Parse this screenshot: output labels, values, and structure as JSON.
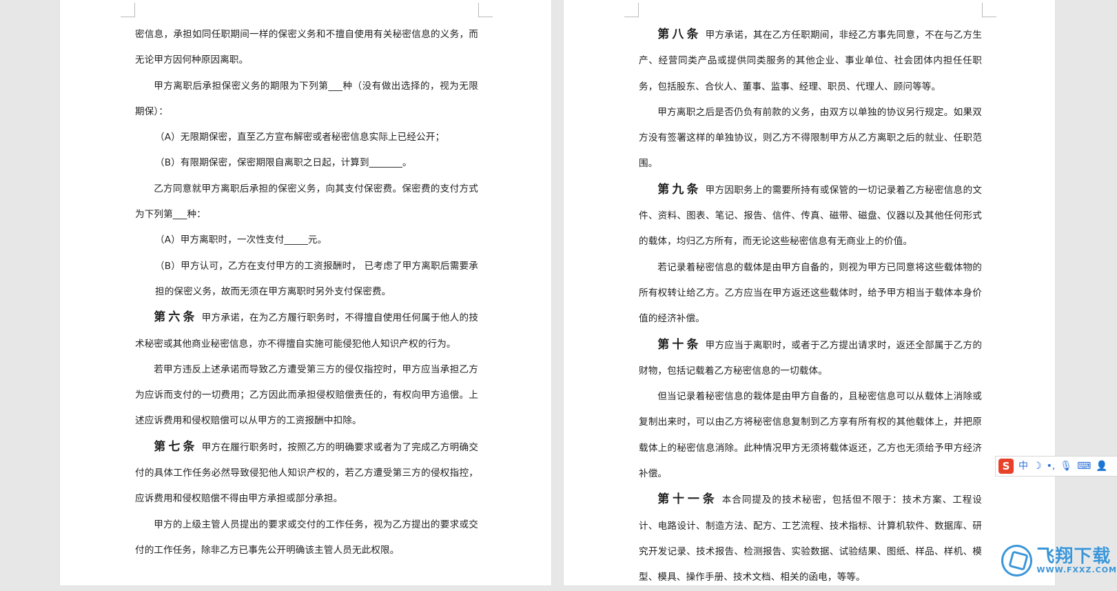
{
  "left_page": {
    "paragraphs": [
      {
        "style": "plain",
        "text": "密信息，承担如同任职期间一样的保密义务和不擅自使用有关秘密信息的义务，而无论甲方因何种原因离职。"
      },
      {
        "style": "indent",
        "text": "甲方离职后承担保密义务的期限为下列第___种（没有做出选择的，视为无限期保）："
      },
      {
        "style": "opt",
        "text": "（A）无限期保密，直至乙方宣布解密或者秘密信息实际上已经公开；"
      },
      {
        "style": "opt",
        "text": "（B）有限期保密，保密期限自离职之日起，计算到_______。"
      },
      {
        "style": "indent",
        "text": "乙方同意就甲方离职后承担的保密义务，向其支付保密费。保密费的支付方式为下列第___种："
      },
      {
        "style": "opt",
        "text": "（A）甲方离职时，一次性支付_____元。"
      },
      {
        "style": "opt",
        "text": "（B）甲方认可，乙方在支付甲方的工资报酬时， 已考虑了甲方离职后需要承担的保密义务，故而无须在甲方离职时另外支付保密费。"
      },
      {
        "style": "article",
        "label": "第六条",
        "text": "甲方承诺，在为乙方履行职务时，不得擅自使用任何属于他人的技术秘密或其他商业秘密信息，亦不得擅自实施可能侵犯他人知识产权的行为。"
      },
      {
        "style": "indent",
        "text": "若甲方违反上述承诺而导致乙方遭受第三方的侵仅指控时，甲方应当承担乙方为应诉而支付的一切费用；乙方因此而承担侵权赔偿责任的，有权向甲方追偿。上述应诉费用和侵权赔偿可以从甲方的工资报酬中扣除。"
      },
      {
        "style": "article",
        "label": "第七条",
        "text": "甲方在履行职务时，按照乙方的明确要求或者为了完成乙方明确交付的具体工作任务必然导致侵犯他人知识产权的，若乙方遭受第三方的侵权指控，应诉费用和侵权赔偿不得由甲方承担或部分承担。"
      },
      {
        "style": "indent",
        "text": "甲方的上级主管人员提出的要求或交付的工作任务，视为乙方提出的要求或交付的工作任务，除非乙方已事先公开明确该主管人员无此权限。"
      }
    ]
  },
  "right_page": {
    "paragraphs": [
      {
        "style": "article",
        "label": "第八条",
        "text": "甲方承诺，其在乙方任职期间，非经乙方事先同意，不在与乙方生产、经营同类产品或提供同类服务的其他企业、事业单位、社会团体内担任任职务，包括股东、合伙人、董事、监事、经理、职员、代理人、顾问等等。"
      },
      {
        "style": "indent",
        "text": "甲方离职之后是否仍负有前款的义务，由双方以单独的协议另行规定。如果双方没有签署这样的单独协议，则乙方不得限制甲方从乙方离职之后的就业、任职范围。"
      },
      {
        "style": "article",
        "label": "第九条",
        "text": "甲方因职务上的需要所持有或保管的一切记录着乙方秘密信息的文件、资料、图表、笔记、报告、信件、传真、磁带、磁盘、仪器以及其他任何形式的载体，均归乙方所有，而无论这些秘密信息有无商业上的价值。"
      },
      {
        "style": "indent",
        "text": "若记录着秘密信息的载体是由甲方自备的，则视为甲方已同意将这些载体物的所有权转让给乙方。乙方应当在甲方返还这些载体时，给予甲方相当于载体本身价值的经济补偿。"
      },
      {
        "style": "article",
        "label": "第十条",
        "text": "甲方应当于离职时，或者于乙方提出请求时，返还全部属于乙方的财物，包括记载着乙方秘密信息的一切载体。"
      },
      {
        "style": "indent",
        "text": "但当记录着秘密信息的栽体是由甲方自备的，且秘密信息可以从载体上消除或复制出来时，可以由乙方将秘密信息复制到乙方享有所有权的其他载体上，并把原载体上的秘密信息消除。此种情况甲方无须将载体返还，乙方也无须给予甲方经济补偿。"
      },
      {
        "style": "article",
        "label": "第十一条",
        "text": "本合同提及的技术秘密，包括但不限于：技术方案、工程设计、电路设计、制造方法、配方、工艺流程、技术指标、计算机软件、数据库、研究开发记录、技术报告、检测报告、实验数据、试验结果、图纸、样品、样机、模型、模具、操作手册、技术文档、相关的函电，等等。"
      }
    ]
  },
  "ime_toolbar": {
    "logo": "S",
    "items": [
      {
        "name": "chinese-mode",
        "text": "中"
      },
      {
        "name": "moon-icon",
        "text": "☽"
      },
      {
        "name": "punctuation-icon",
        "text": "•,"
      },
      {
        "name": "microphone-icon",
        "text": "🎙"
      },
      {
        "name": "keyboard-icon",
        "text": "⌨"
      },
      {
        "name": "user-icon",
        "text": "👤"
      }
    ]
  },
  "watermark": {
    "cn": "飞翔下载",
    "en": "WWW.FXXZ.COM"
  },
  "colors": {
    "background": "#e7e7e7",
    "page": "#ffffff",
    "text": "#1f1f1f",
    "ime_accent": "#2a6fd6",
    "watermark": "#3a95d8"
  }
}
